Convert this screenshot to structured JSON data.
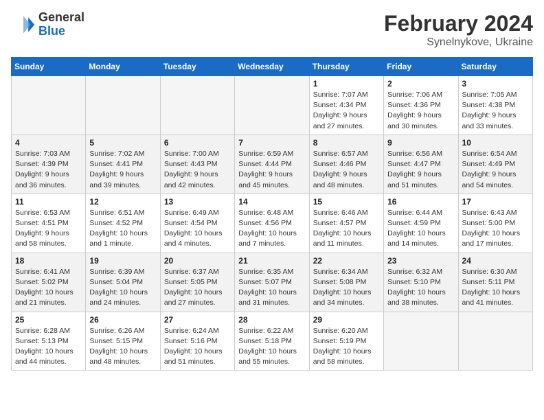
{
  "header": {
    "logo": {
      "general": "General",
      "blue": "Blue"
    },
    "title": "February 2024",
    "location": "Synelnykove, Ukraine"
  },
  "calendar": {
    "days_of_week": [
      "Sunday",
      "Monday",
      "Tuesday",
      "Wednesday",
      "Thursday",
      "Friday",
      "Saturday"
    ],
    "weeks": [
      [
        {
          "day": "",
          "info": ""
        },
        {
          "day": "",
          "info": ""
        },
        {
          "day": "",
          "info": ""
        },
        {
          "day": "",
          "info": ""
        },
        {
          "day": "1",
          "info": "Sunrise: 7:07 AM\nSunset: 4:34 PM\nDaylight: 9 hours\nand 27 minutes."
        },
        {
          "day": "2",
          "info": "Sunrise: 7:06 AM\nSunset: 4:36 PM\nDaylight: 9 hours\nand 30 minutes."
        },
        {
          "day": "3",
          "info": "Sunrise: 7:05 AM\nSunset: 4:38 PM\nDaylight: 9 hours\nand 33 minutes."
        }
      ],
      [
        {
          "day": "4",
          "info": "Sunrise: 7:03 AM\nSunset: 4:39 PM\nDaylight: 9 hours\nand 36 minutes."
        },
        {
          "day": "5",
          "info": "Sunrise: 7:02 AM\nSunset: 4:41 PM\nDaylight: 9 hours\nand 39 minutes."
        },
        {
          "day": "6",
          "info": "Sunrise: 7:00 AM\nSunset: 4:43 PM\nDaylight: 9 hours\nand 42 minutes."
        },
        {
          "day": "7",
          "info": "Sunrise: 6:59 AM\nSunset: 4:44 PM\nDaylight: 9 hours\nand 45 minutes."
        },
        {
          "day": "8",
          "info": "Sunrise: 6:57 AM\nSunset: 4:46 PM\nDaylight: 9 hours\nand 48 minutes."
        },
        {
          "day": "9",
          "info": "Sunrise: 6:56 AM\nSunset: 4:47 PM\nDaylight: 9 hours\nand 51 minutes."
        },
        {
          "day": "10",
          "info": "Sunrise: 6:54 AM\nSunset: 4:49 PM\nDaylight: 9 hours\nand 54 minutes."
        }
      ],
      [
        {
          "day": "11",
          "info": "Sunrise: 6:53 AM\nSunset: 4:51 PM\nDaylight: 9 hours\nand 58 minutes."
        },
        {
          "day": "12",
          "info": "Sunrise: 6:51 AM\nSunset: 4:52 PM\nDaylight: 10 hours\nand 1 minute."
        },
        {
          "day": "13",
          "info": "Sunrise: 6:49 AM\nSunset: 4:54 PM\nDaylight: 10 hours\nand 4 minutes."
        },
        {
          "day": "14",
          "info": "Sunrise: 6:48 AM\nSunset: 4:56 PM\nDaylight: 10 hours\nand 7 minutes."
        },
        {
          "day": "15",
          "info": "Sunrise: 6:46 AM\nSunset: 4:57 PM\nDaylight: 10 hours\nand 11 minutes."
        },
        {
          "day": "16",
          "info": "Sunrise: 6:44 AM\nSunset: 4:59 PM\nDaylight: 10 hours\nand 14 minutes."
        },
        {
          "day": "17",
          "info": "Sunrise: 6:43 AM\nSunset: 5:00 PM\nDaylight: 10 hours\nand 17 minutes."
        }
      ],
      [
        {
          "day": "18",
          "info": "Sunrise: 6:41 AM\nSunset: 5:02 PM\nDaylight: 10 hours\nand 21 minutes."
        },
        {
          "day": "19",
          "info": "Sunrise: 6:39 AM\nSunset: 5:04 PM\nDaylight: 10 hours\nand 24 minutes."
        },
        {
          "day": "20",
          "info": "Sunrise: 6:37 AM\nSunset: 5:05 PM\nDaylight: 10 hours\nand 27 minutes."
        },
        {
          "day": "21",
          "info": "Sunrise: 6:35 AM\nSunset: 5:07 PM\nDaylight: 10 hours\nand 31 minutes."
        },
        {
          "day": "22",
          "info": "Sunrise: 6:34 AM\nSunset: 5:08 PM\nDaylight: 10 hours\nand 34 minutes."
        },
        {
          "day": "23",
          "info": "Sunrise: 6:32 AM\nSunset: 5:10 PM\nDaylight: 10 hours\nand 38 minutes."
        },
        {
          "day": "24",
          "info": "Sunrise: 6:30 AM\nSunset: 5:11 PM\nDaylight: 10 hours\nand 41 minutes."
        }
      ],
      [
        {
          "day": "25",
          "info": "Sunrise: 6:28 AM\nSunset: 5:13 PM\nDaylight: 10 hours\nand 44 minutes."
        },
        {
          "day": "26",
          "info": "Sunrise: 6:26 AM\nSunset: 5:15 PM\nDaylight: 10 hours\nand 48 minutes."
        },
        {
          "day": "27",
          "info": "Sunrise: 6:24 AM\nSunset: 5:16 PM\nDaylight: 10 hours\nand 51 minutes."
        },
        {
          "day": "28",
          "info": "Sunrise: 6:22 AM\nSunset: 5:18 PM\nDaylight: 10 hours\nand 55 minutes."
        },
        {
          "day": "29",
          "info": "Sunrise: 6:20 AM\nSunset: 5:19 PM\nDaylight: 10 hours\nand 58 minutes."
        },
        {
          "day": "",
          "info": ""
        },
        {
          "day": "",
          "info": ""
        }
      ]
    ]
  }
}
